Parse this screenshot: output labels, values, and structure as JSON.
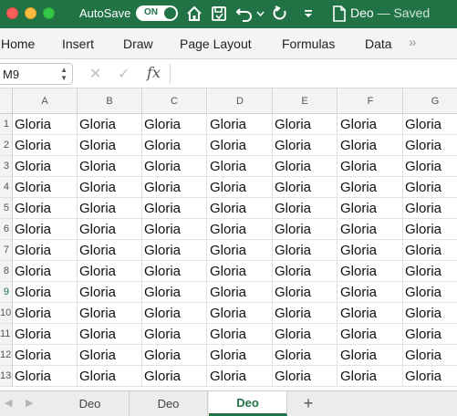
{
  "titlebar": {
    "autosave_label": "AutoSave",
    "autosave_toggle": "ON",
    "doc_name": "Deo",
    "doc_status": "— Saved",
    "icons": [
      "home-icon",
      "save-icon",
      "undo-icon",
      "redo-icon",
      "customize-toolbar-icon",
      "document-icon"
    ],
    "accent_color": "#217346"
  },
  "ribbon": {
    "tabs": [
      "Home",
      "Insert",
      "Draw",
      "Page Layout",
      "Formulas",
      "Data"
    ],
    "more": "»"
  },
  "formula_bar": {
    "name_box": "M9",
    "cancel_symbol": "✕",
    "enter_symbol": "✓",
    "fx_label": "fx",
    "value": ""
  },
  "grid": {
    "columns": [
      "A",
      "B",
      "C",
      "D",
      "E",
      "F",
      "G"
    ],
    "rows": [
      {
        "num": "1",
        "cells": [
          "Gloria",
          "Gloria",
          "Gloria",
          "Gloria",
          "Gloria",
          "Gloria",
          "Gloria"
        ]
      },
      {
        "num": "2",
        "cells": [
          "Gloria",
          "Gloria",
          "Gloria",
          "Gloria",
          "Gloria",
          "Gloria",
          "Gloria"
        ]
      },
      {
        "num": "3",
        "cells": [
          "Gloria",
          "Gloria",
          "Gloria",
          "Gloria",
          "Gloria",
          "Gloria",
          "Gloria"
        ]
      },
      {
        "num": "4",
        "cells": [
          "Gloria",
          "Gloria",
          "Gloria",
          "Gloria",
          "Gloria",
          "Gloria",
          "Gloria"
        ]
      },
      {
        "num": "5",
        "cells": [
          "Gloria",
          "Gloria",
          "Gloria",
          "Gloria",
          "Gloria",
          "Gloria",
          "Gloria"
        ]
      },
      {
        "num": "6",
        "cells": [
          "Gloria",
          "Gloria",
          "Gloria",
          "Gloria",
          "Gloria",
          "Gloria",
          "Gloria"
        ]
      },
      {
        "num": "7",
        "cells": [
          "Gloria",
          "Gloria",
          "Gloria",
          "Gloria",
          "Gloria",
          "Gloria",
          "Gloria"
        ]
      },
      {
        "num": "8",
        "cells": [
          "Gloria",
          "Gloria",
          "Gloria",
          "Gloria",
          "Gloria",
          "Gloria",
          "Gloria"
        ]
      },
      {
        "num": "9",
        "cells": [
          "Gloria",
          "Gloria",
          "Gloria",
          "Gloria",
          "Gloria",
          "Gloria",
          "Gloria"
        ]
      },
      {
        "num": "10",
        "cells": [
          "Gloria",
          "Gloria",
          "Gloria",
          "Gloria",
          "Gloria",
          "Gloria",
          "Gloria"
        ]
      },
      {
        "num": "11",
        "cells": [
          "Gloria",
          "Gloria",
          "Gloria",
          "Gloria",
          "Gloria",
          "Gloria",
          "Gloria"
        ]
      },
      {
        "num": "12",
        "cells": [
          "Gloria",
          "Gloria",
          "Gloria",
          "Gloria",
          "Gloria",
          "Gloria",
          "Gloria"
        ]
      },
      {
        "num": "13",
        "cells": [
          "Gloria",
          "Gloria",
          "Gloria",
          "Gloria",
          "Gloria",
          "Gloria",
          "Gloria"
        ]
      }
    ],
    "active_row": "9"
  },
  "sheet_tabs": {
    "tabs": [
      "Deo",
      "Deo",
      "Deo"
    ],
    "active_index": 2,
    "add_symbol": "+"
  }
}
